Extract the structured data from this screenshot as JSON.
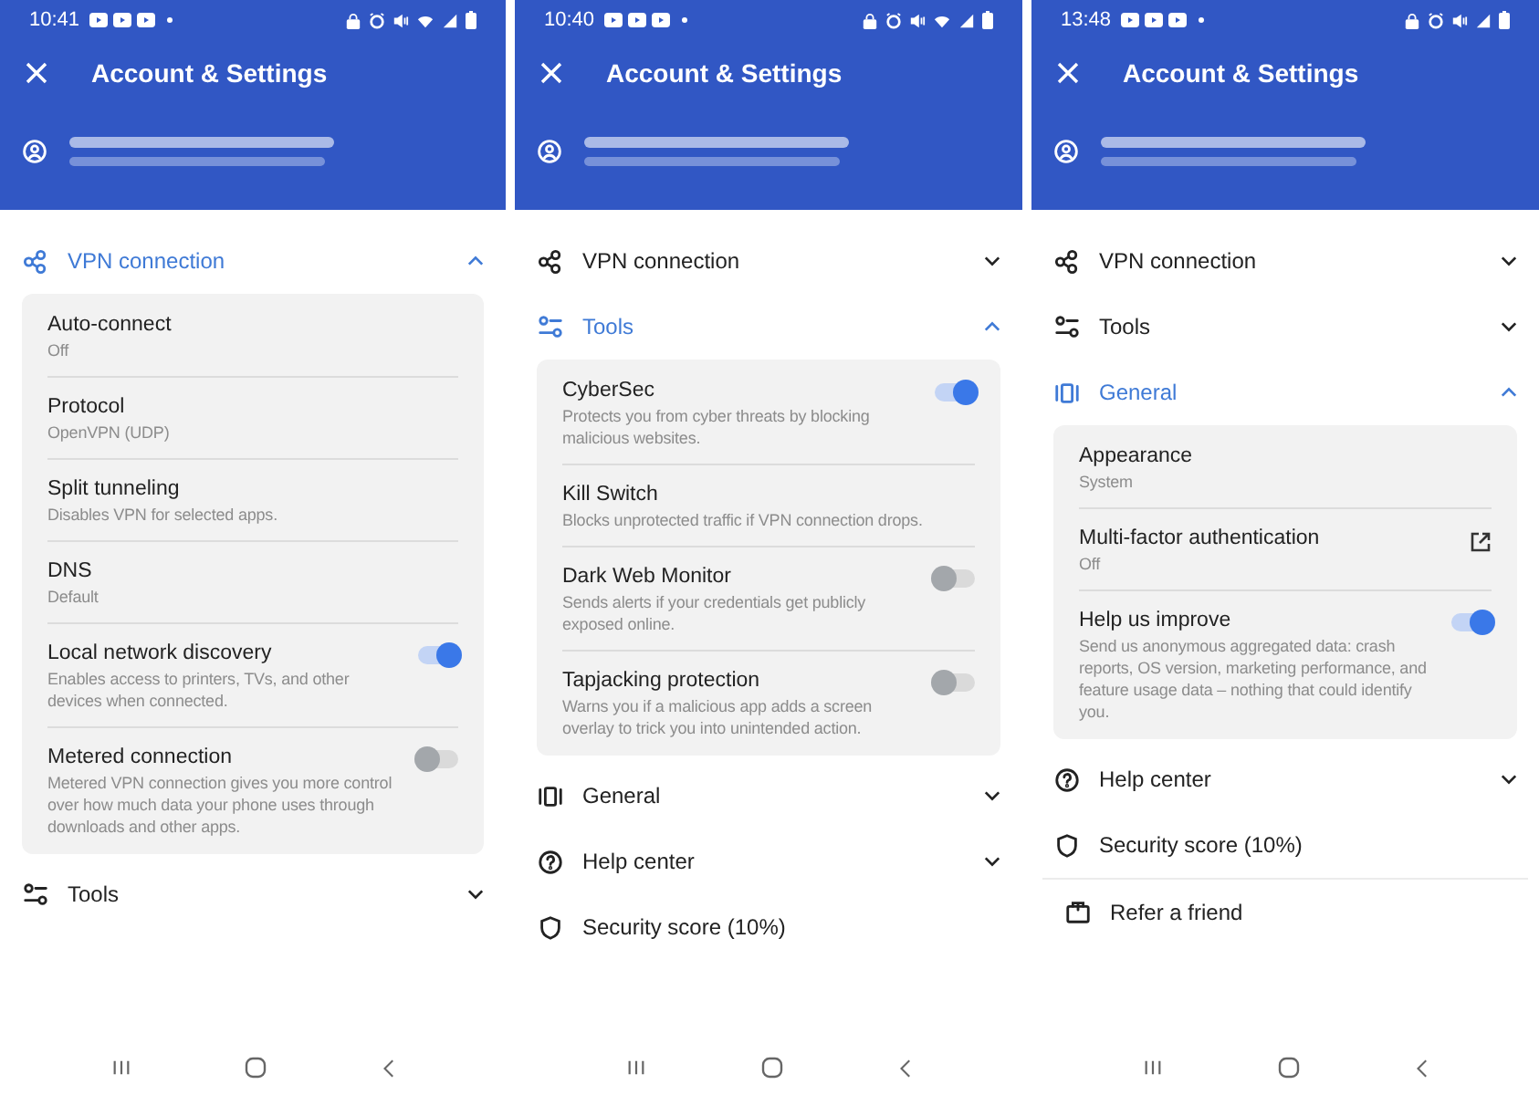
{
  "phones": [
    {
      "status_time": "10:41",
      "title": "Account & Settings",
      "sections": [
        {
          "label": "VPN connection",
          "kind": "group",
          "expanded": true,
          "items": [
            {
              "kind": "plain",
              "title": "Auto-connect",
              "subtitle": "Off"
            },
            {
              "kind": "plain",
              "title": "Protocol",
              "subtitle": "OpenVPN (UDP)"
            },
            {
              "kind": "plain",
              "title": "Split tunneling",
              "subtitle": "Disables VPN for selected apps."
            },
            {
              "kind": "plain",
              "title": "DNS",
              "subtitle": "Default"
            },
            {
              "kind": "toggle",
              "title": "Local network discovery",
              "subtitle": "Enables access to printers, TVs, and other devices when connected.",
              "on": true
            },
            {
              "kind": "toggle",
              "title": "Metered connection",
              "subtitle": "Metered VPN connection gives you more control over how much data your phone uses through downloads and other apps.",
              "on": false
            }
          ]
        },
        {
          "label": "Tools",
          "kind": "group",
          "expanded": false
        }
      ]
    },
    {
      "status_time": "10:40",
      "title": "Account & Settings",
      "sections": [
        {
          "label": "VPN connection",
          "kind": "group",
          "expanded": false
        },
        {
          "label": "Tools",
          "kind": "group",
          "expanded": true,
          "items": [
            {
              "kind": "toggle",
              "title": "CyberSec",
              "subtitle": "Protects you from cyber threats by blocking malicious websites.",
              "on": true
            },
            {
              "kind": "plain",
              "title": "Kill Switch",
              "subtitle": "Blocks unprotected traffic if VPN connection drops."
            },
            {
              "kind": "toggle",
              "title": "Dark Web Monitor",
              "subtitle": "Sends alerts if your credentials get publicly exposed online.",
              "on": false
            },
            {
              "kind": "toggle",
              "title": "Tapjacking protection",
              "subtitle": "Warns you if a malicious app adds a screen overlay to trick you into unintended action.",
              "on": false
            }
          ]
        },
        {
          "label": "General",
          "kind": "group",
          "expanded": false
        },
        {
          "label": "Help center",
          "kind": "group",
          "expanded": false
        },
        {
          "label": "Security score (10%)",
          "kind": "link"
        }
      ]
    },
    {
      "status_time": "13:48",
      "title": "Account & Settings",
      "sections": [
        {
          "label": "VPN connection",
          "kind": "group",
          "expanded": false
        },
        {
          "label": "Tools",
          "kind": "group",
          "expanded": false
        },
        {
          "label": "General",
          "kind": "group",
          "expanded": true,
          "items": [
            {
              "kind": "plain",
              "title": "Appearance",
              "subtitle": "System"
            },
            {
              "kind": "external",
              "title": "Multi-factor authentication",
              "subtitle": "Off"
            },
            {
              "kind": "toggle",
              "title": "Help us improve",
              "subtitle": "Send us anonymous aggregated data: crash reports, OS version, marketing performance, and feature usage data – nothing that could identify you.",
              "on": true
            }
          ]
        },
        {
          "label": "Help center",
          "kind": "group",
          "expanded": false
        },
        {
          "label": "Security score (10%)",
          "kind": "link"
        },
        {
          "label": "Refer a friend",
          "kind": "link"
        }
      ]
    }
  ]
}
